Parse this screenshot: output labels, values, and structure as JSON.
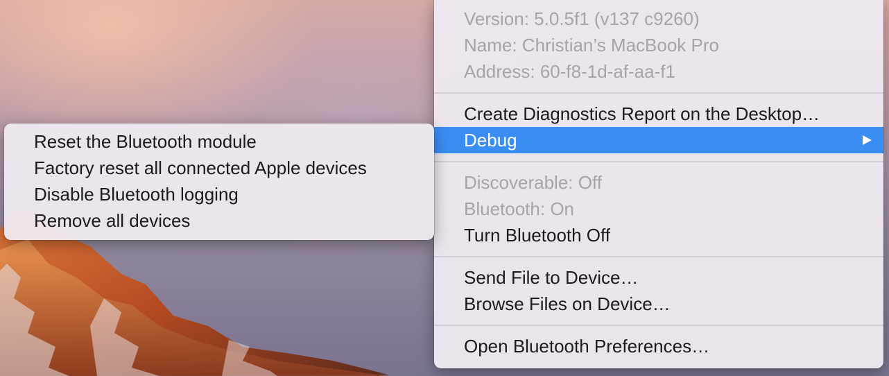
{
  "bluetooth_menu": {
    "info": {
      "version": "Version: 5.0.5f1 (v137 c9260)",
      "name": "Name: Christian’s MacBook Pro",
      "address": "Address: 60-f8-1d-af-aa-f1"
    },
    "create_diagnostics": "Create Diagnostics Report on the Desktop…",
    "debug": {
      "label": "Debug",
      "arrow_icon": "chevron-right-icon"
    },
    "discoverable": "Discoverable: Off",
    "bluetooth_status": "Bluetooth: On",
    "turn_off": "Turn Bluetooth Off",
    "send_file": "Send File to Device…",
    "browse_files": "Browse Files on Device…",
    "open_preferences": "Open Bluetooth Preferences…"
  },
  "debug_submenu": {
    "items": [
      "Reset the Bluetooth module",
      "Factory reset all connected Apple devices",
      "Disable Bluetooth logging",
      "Remove all devices"
    ]
  },
  "colors": {
    "highlight": "#3a8ef3",
    "disabled_text": "#a8a3ab",
    "text": "#1b1b1b"
  }
}
